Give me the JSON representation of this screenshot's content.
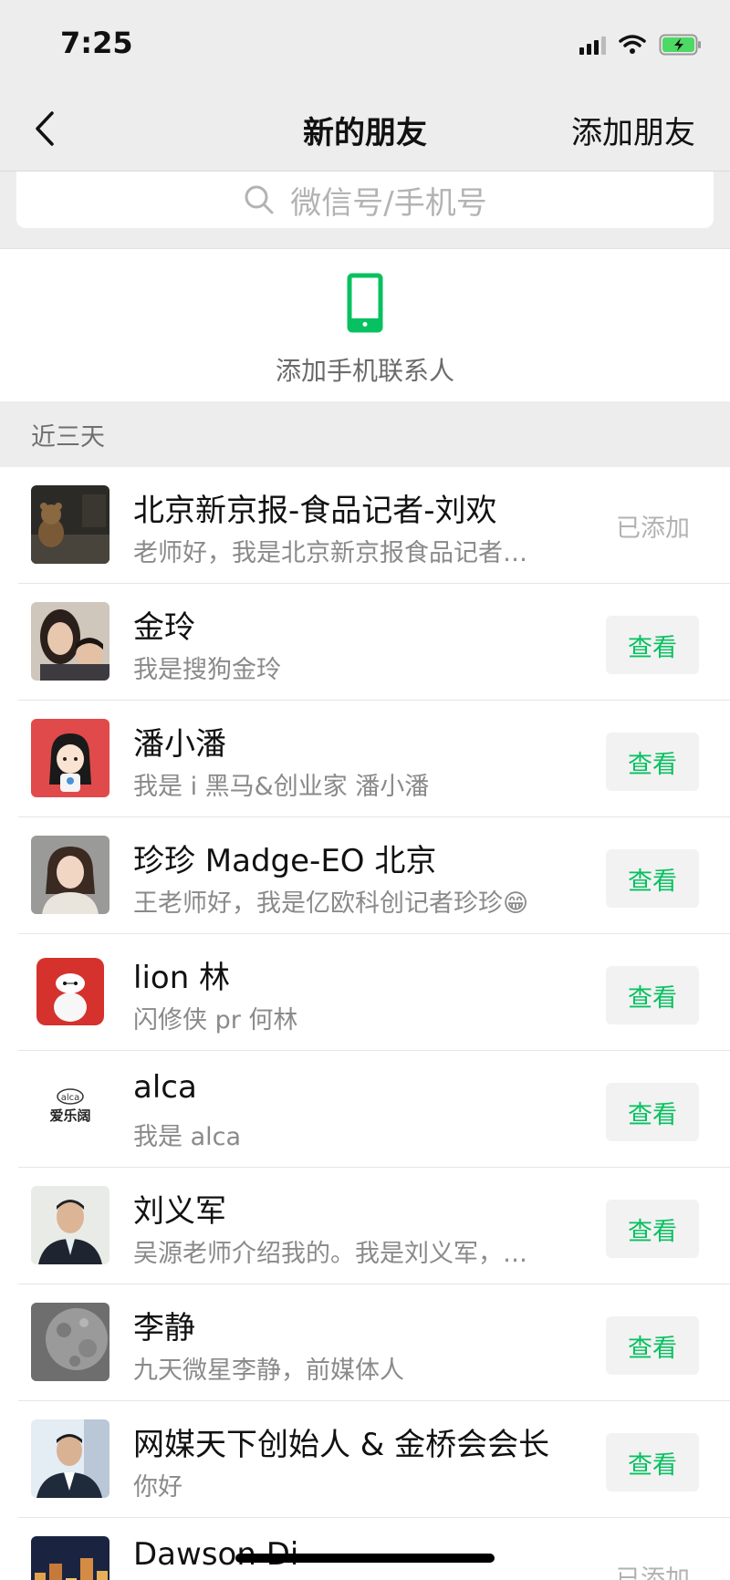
{
  "status_bar": {
    "time": "7:25"
  },
  "nav": {
    "title": "新的朋友",
    "action": "添加朋友"
  },
  "search": {
    "placeholder": "微信号/手机号"
  },
  "phone_contacts": {
    "label": "添加手机联系人"
  },
  "section": {
    "title": "近三天"
  },
  "colors": {
    "accent": "#07c160",
    "background": "#ededed"
  },
  "friends": [
    {
      "name": "北京新京报-食品记者-刘欢",
      "message": "老师好，我是北京新京报食品记者…",
      "action": "已添加",
      "avatar": "teddy-bear-photo"
    },
    {
      "name": "金玲",
      "message": "我是搜狗金玲",
      "action": "查看",
      "avatar": "mother-child-photo"
    },
    {
      "name": "潘小潘",
      "message": "我是 i 黑马&创业家 潘小潘",
      "action": "查看",
      "avatar": "cartoon-girl"
    },
    {
      "name": "珍珍 Madge-EO 北京",
      "message": "王老师好，我是亿欧科创记者珍珍😁",
      "action": "查看",
      "avatar": "woman-portrait"
    },
    {
      "name": "lion 林",
      "message": "闪修侠 pr 何林",
      "action": "查看",
      "avatar": "baymax-icon"
    },
    {
      "name": "alca",
      "message": "我是 alca",
      "action": "查看",
      "avatar": "alca-logo"
    },
    {
      "name": "刘义军",
      "message": "吴源老师介绍我的。我是刘义军，…",
      "action": "查看",
      "avatar": "man-portrait"
    },
    {
      "name": "李静",
      "message": "九天微星李静，前媒体人",
      "action": "查看",
      "avatar": "moon-texture"
    },
    {
      "name": "网媒天下创始人 & 金桥会会长",
      "message": "你好",
      "action": "查看",
      "avatar": "businessman-portrait"
    },
    {
      "name": "Dawson Di",
      "message": "",
      "action": "已添加",
      "avatar": "city-night"
    }
  ],
  "alca_logo": {
    "top": "alca",
    "bottom": "爱乐阔"
  }
}
